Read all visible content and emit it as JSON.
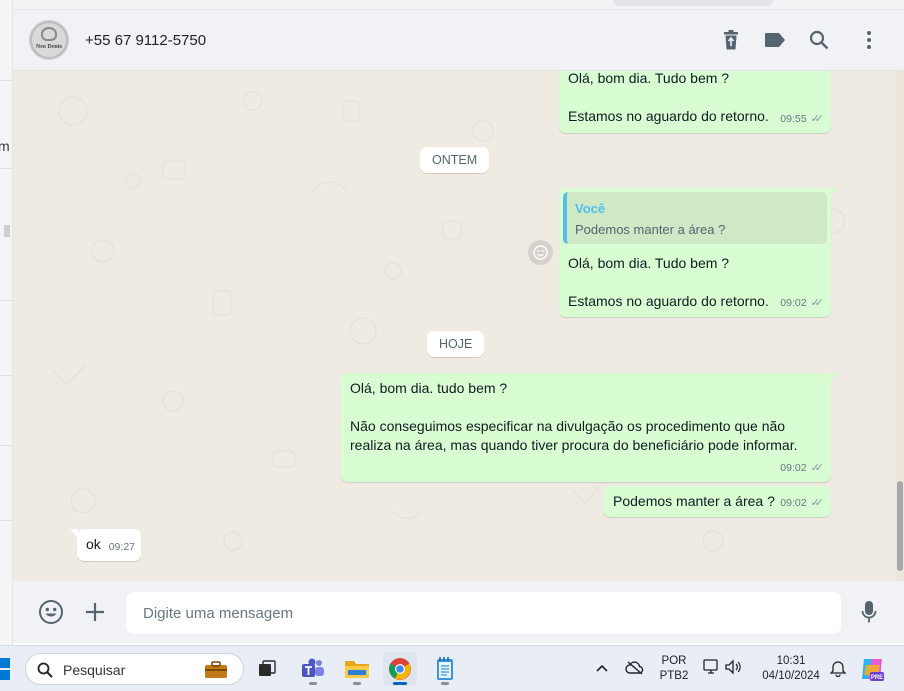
{
  "window": {
    "background_sliver_text": "m"
  },
  "header": {
    "avatar_brand": "Neo Dents",
    "contact": "+55 67 9112-5750",
    "icons": [
      "delete-icon",
      "label-icon",
      "search-icon",
      "more-icon"
    ]
  },
  "chat": {
    "messages": [
      {
        "direction": "out",
        "line1": "Olá, bom dia. Tudo bem ?",
        "line2": "Estamos no aguardo do retorno.",
        "time": "09:55"
      },
      {
        "direction": "out",
        "quoted_author": "Você",
        "quoted_text": "Podemos manter a área ?",
        "line1": "Olá, bom dia. Tudo bem ?",
        "line2": "Estamos no aguardo do retorno.",
        "time": "09:02"
      },
      {
        "direction": "out",
        "line1": "Olá, bom dia. tudo bem ?",
        "line2": "Não conseguimos especificar na divulgação os procedimento que não",
        "line3": "realiza na área, mas quando tiver procura do beneficiário pode informar.",
        "time": "09:02"
      },
      {
        "direction": "out",
        "line1": "Podemos manter a área ?",
        "time": "09:02"
      },
      {
        "direction": "in",
        "line1": "ok",
        "time": "09:27"
      }
    ],
    "date_dividers": [
      "ONTEM",
      "HOJE"
    ],
    "read_receipt": "✓✓"
  },
  "composer": {
    "placeholder": "Digite uma mensagem",
    "icons": [
      "emoji-icon",
      "plus-icon",
      "microphone-icon"
    ]
  },
  "taskbar": {
    "search_label": "Pesquisar",
    "apps": [
      "widgets-icon",
      "task-view-icon",
      "teams-icon",
      "file-explorer-icon",
      "chrome-icon",
      "notepad-icon"
    ],
    "language": "POR",
    "layout": "PTB2",
    "time": "10:31",
    "date": "04/10/2024"
  },
  "colors": {
    "outgoing_bubble": "#d9fdd3",
    "incoming_bubble": "#ffffff",
    "chat_background": "#efeae2",
    "quote_author": "#53bdeb"
  }
}
